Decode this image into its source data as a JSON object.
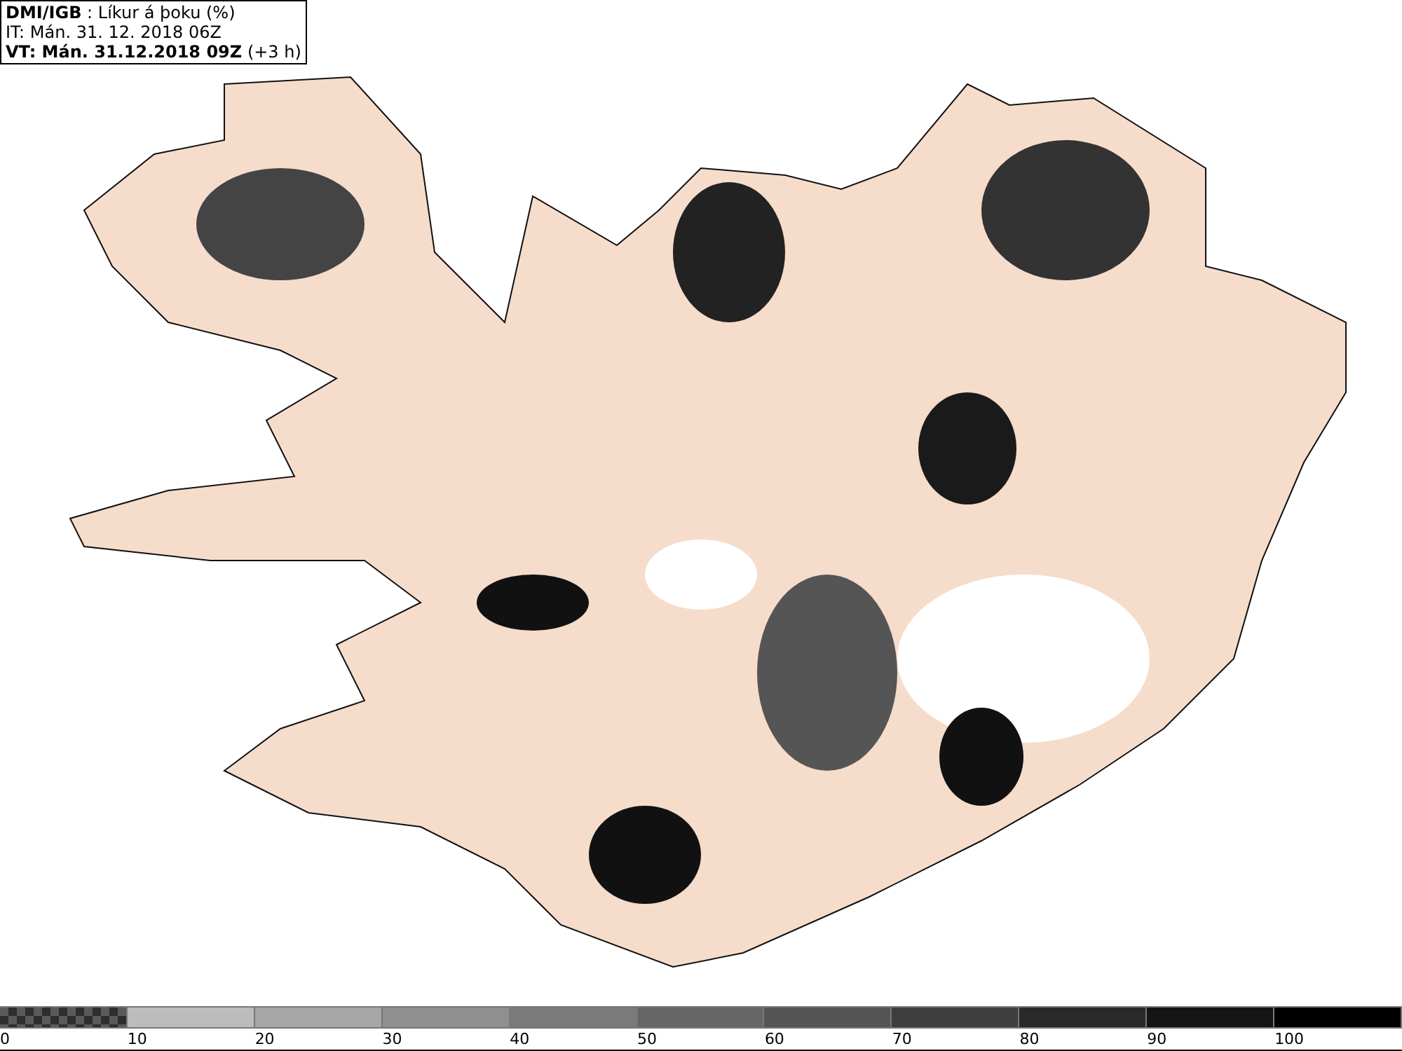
{
  "header": {
    "source": "DMI/IGB",
    "title": ": Líkur á þoku (%)",
    "issue": "IT: Mán. 31. 12. 2018 06Z",
    "valid": "VT: Mán. 31.12.2018 09Z",
    "offset": "(+3 h)"
  },
  "legend": {
    "segments": [
      {
        "kind": "checker",
        "color": "#5a5a5a"
      },
      {
        "kind": "solid",
        "color": "#bcbcbc"
      },
      {
        "kind": "solid",
        "color": "#a6a6a6"
      },
      {
        "kind": "solid",
        "color": "#8f8f8f"
      },
      {
        "kind": "solid",
        "color": "#7a7a7a"
      },
      {
        "kind": "solid",
        "color": "#666666"
      },
      {
        "kind": "solid",
        "color": "#545454"
      },
      {
        "kind": "solid",
        "color": "#3e3e3e"
      },
      {
        "kind": "solid",
        "color": "#2a2a2a"
      },
      {
        "kind": "solid",
        "color": "#151515"
      },
      {
        "kind": "solid",
        "color": "#000000"
      }
    ],
    "labels": [
      "0",
      "10",
      "20",
      "30",
      "40",
      "50",
      "60",
      "70",
      "80",
      "90",
      "100"
    ]
  }
}
